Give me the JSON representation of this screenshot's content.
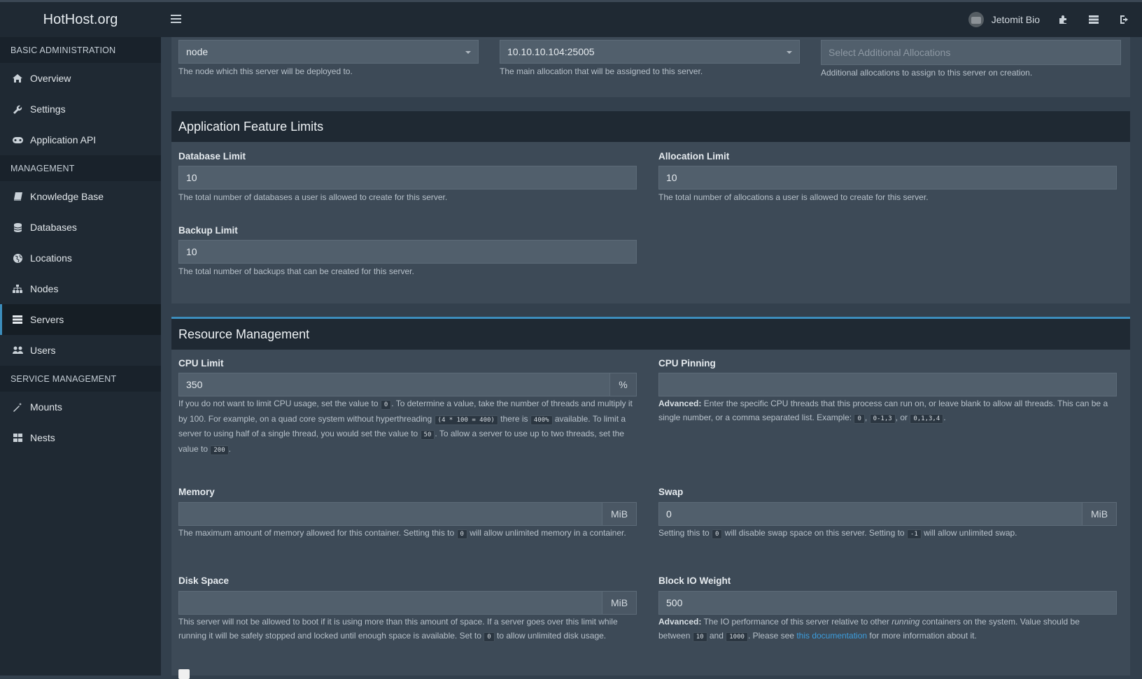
{
  "app": {
    "brand": "HotHost.org",
    "user_name": "Jetomit Bio"
  },
  "sidebar": {
    "sections": [
      {
        "header": "BASIC ADMINISTRATION",
        "items": [
          {
            "label": "Overview",
            "icon": "home-icon"
          },
          {
            "label": "Settings",
            "icon": "wrench-icon"
          },
          {
            "label": "Application API",
            "icon": "gamepad-icon"
          }
        ]
      },
      {
        "header": "MANAGEMENT",
        "items": [
          {
            "label": "Knowledge Base",
            "icon": "book-icon"
          },
          {
            "label": "Databases",
            "icon": "database-icon"
          },
          {
            "label": "Locations",
            "icon": "globe-icon"
          },
          {
            "label": "Nodes",
            "icon": "sitemap-icon"
          },
          {
            "label": "Servers",
            "icon": "server-icon",
            "active": true
          },
          {
            "label": "Users",
            "icon": "users-icon"
          }
        ]
      },
      {
        "header": "SERVICE MANAGEMENT",
        "items": [
          {
            "label": "Mounts",
            "icon": "magic-icon"
          },
          {
            "label": "Nests",
            "icon": "grid-icon"
          }
        ]
      }
    ]
  },
  "deployment": {
    "node": {
      "value": "node",
      "help": "The node which this server will be deployed to."
    },
    "allocation": {
      "value": "10.10.10.104:25005",
      "help": "The main allocation that will be assigned to this server."
    },
    "additional": {
      "placeholder": "Select Additional Allocations",
      "help": "Additional allocations to assign to this server on creation."
    }
  },
  "feature_limits": {
    "title": "Application Feature Limits",
    "database": {
      "label": "Database Limit",
      "value": "10",
      "help": "The total number of databases a user is allowed to create for this server."
    },
    "allocation": {
      "label": "Allocation Limit",
      "value": "10",
      "help": "The total number of allocations a user is allowed to create for this server."
    },
    "backup": {
      "label": "Backup Limit",
      "value": "10",
      "help": "The total number of backups that can be created for this server."
    }
  },
  "resources": {
    "title": "Resource Management",
    "cpu_limit": {
      "label": "CPU Limit",
      "value": "350",
      "addon": "%"
    },
    "cpu_pinning": {
      "label": "CPU Pinning",
      "value": ""
    },
    "memory": {
      "label": "Memory",
      "value": "",
      "addon": "MiB"
    },
    "swap": {
      "label": "Swap",
      "value": "0",
      "addon": "MiB"
    },
    "disk": {
      "label": "Disk Space",
      "value": "",
      "addon": "MiB"
    },
    "block_io": {
      "label": "Block IO Weight",
      "value": "500"
    },
    "link_text": "this documentation"
  },
  "colors": {
    "accent": "#3c8dbc",
    "sidebar_bg": "#1f2933",
    "content_bg": "#33404d",
    "panel_bg": "#3d4a57"
  }
}
